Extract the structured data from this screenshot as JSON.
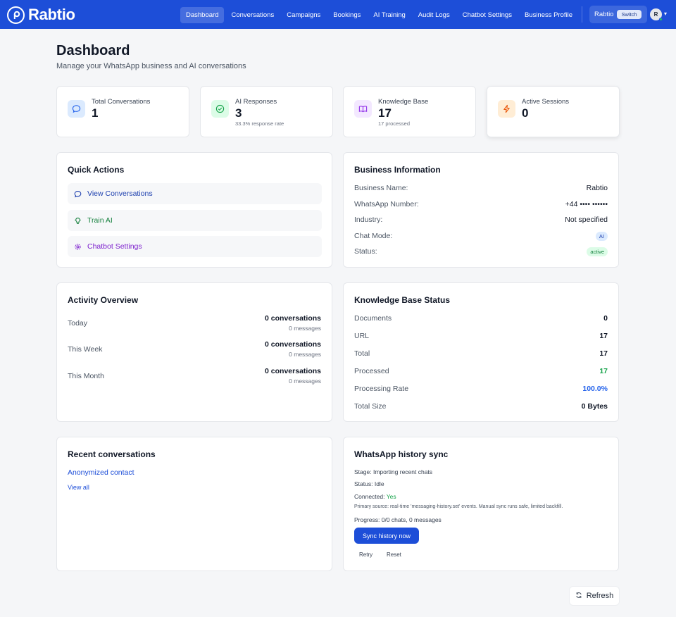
{
  "brand": {
    "name": "Rabtio",
    "color": "#1d4ed8",
    "icon": "rabtio-logo-icon"
  },
  "nav": {
    "items": [
      {
        "label": "Dashboard",
        "active": true
      },
      {
        "label": "Conversations"
      },
      {
        "label": "Campaigns"
      },
      {
        "label": "Bookings"
      },
      {
        "label": "AI Training"
      },
      {
        "label": "Audit Logs"
      },
      {
        "label": "Chatbot Settings"
      },
      {
        "label": "Business Profile"
      }
    ],
    "business_name": "Rabtio",
    "switch_label": "Switch",
    "avatar_initial": "R"
  },
  "page": {
    "title": "Dashboard",
    "subtitle": "Manage your WhatsApp business and AI conversations"
  },
  "stats": [
    {
      "label": "Total Conversations",
      "value": "1",
      "note": "",
      "icon": "chat-bubble-icon",
      "color": "#2563eb"
    },
    {
      "label": "AI Responses",
      "value": "3",
      "note": "33.3% response rate",
      "icon": "check-circle-icon",
      "color": "#16a34a"
    },
    {
      "label": "Knowledge Base",
      "value": "17",
      "note": "17 processed",
      "icon": "book-icon",
      "color": "#9333ea"
    },
    {
      "label": "Active Sessions",
      "value": "0",
      "note": "",
      "icon": "lightning-icon",
      "color": "#ea580c"
    }
  ],
  "quick_actions": {
    "title": "Quick Actions",
    "items": [
      {
        "label": "View Conversations",
        "icon": "chat-bubble-icon",
        "color": "#1e40af"
      },
      {
        "label": "Train AI",
        "icon": "lightbulb-icon",
        "color": "#15803d"
      },
      {
        "label": "Chatbot Settings",
        "icon": "gear-icon",
        "color": "#7e22ce"
      }
    ]
  },
  "business_info": {
    "title": "Business Information",
    "rows": [
      {
        "label": "Business Name:",
        "value": "Rabtio"
      },
      {
        "label": "WhatsApp Number:",
        "value": "+44 •••• ••••••"
      },
      {
        "label": "Industry:",
        "value": "Not specified"
      },
      {
        "label": "Chat Mode:",
        "value": "AI"
      },
      {
        "label": "Status:",
        "value": "active"
      }
    ]
  },
  "activity": {
    "title": "Activity Overview",
    "rows": [
      {
        "label": "Today",
        "conversations": "0 conversations",
        "messages": "0 messages"
      },
      {
        "label": "This Week",
        "conversations": "0 conversations",
        "messages": "0 messages"
      },
      {
        "label": "This Month",
        "conversations": "0 conversations",
        "messages": "0 messages"
      }
    ]
  },
  "kb_status": {
    "title": "Knowledge Base Status",
    "rows": [
      {
        "label": "Documents",
        "value": "0",
        "color": "#111827"
      },
      {
        "label": "URL",
        "value": "17",
        "color": "#111827"
      },
      {
        "label": "Total",
        "value": "17",
        "color": "#111827"
      },
      {
        "label": "Processed",
        "value": "17",
        "color": "#16a34a"
      },
      {
        "label": "Processing Rate",
        "value": "100.0%",
        "color": "#2563eb"
      },
      {
        "label": "Total Size",
        "value": "0 Bytes",
        "color": "#111827"
      }
    ]
  },
  "recent": {
    "title": "Recent conversations",
    "contact": "Anonymized contact",
    "view_all": "View all"
  },
  "sync": {
    "title": "WhatsApp history sync",
    "stage_label": "Stage:",
    "stage_value": "Importing recent chats",
    "status_label": "Status:",
    "status_value": "Idle",
    "connected_label": "Connected:",
    "connected_value": "Yes",
    "primary_source": "Primary source: real-time 'messaging-history.set' events. Manual sync runs safe, limited backfill.",
    "progress_label": "Progress:",
    "progress_value": "0/0 chats, 0 messages",
    "sync_button": "Sync history now",
    "retry": "Retry",
    "reset": "Reset"
  },
  "refresh_label": "Refresh"
}
